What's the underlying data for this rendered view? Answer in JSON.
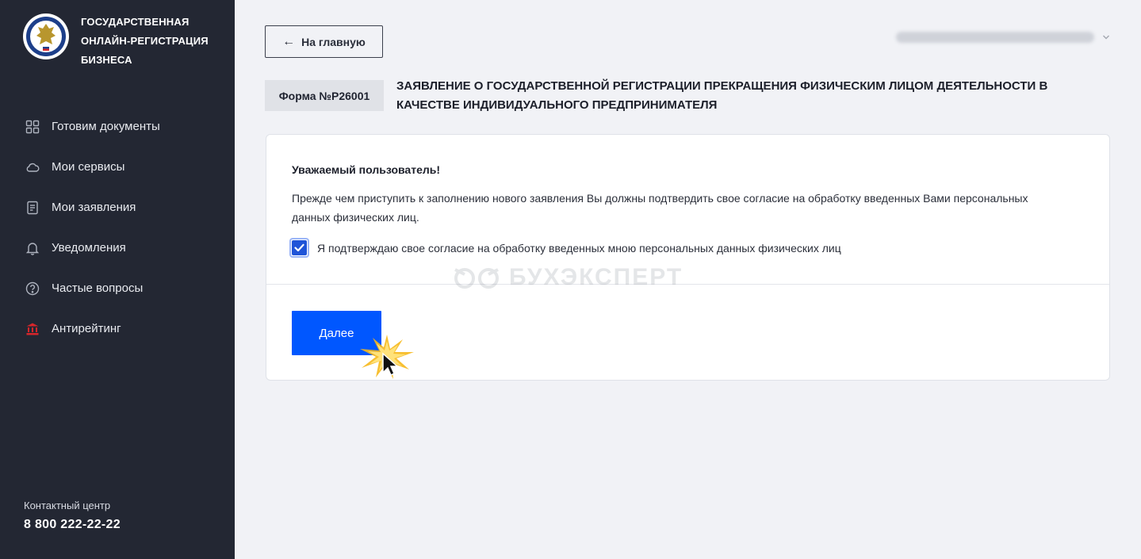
{
  "sidebar": {
    "brand": {
      "line1": "ГОСУДАРСТВЕННАЯ",
      "line2": "ОНЛАЙН-РЕГИСТРАЦИЯ",
      "line3": "БИЗНЕСА",
      "emblem_icon": "tax-service-emblem-icon"
    },
    "items": [
      {
        "label": "Готовим документы",
        "icon": "grid-icon"
      },
      {
        "label": "Мои сервисы",
        "icon": "cloud-icon"
      },
      {
        "label": "Мои заявления",
        "icon": "document-icon"
      },
      {
        "label": "Уведомления",
        "icon": "bell-icon"
      },
      {
        "label": "Частые вопросы",
        "icon": "question-icon"
      },
      {
        "label": "Антирейтинг",
        "icon": "bank-icon"
      }
    ],
    "contact": {
      "label": "Контактный центр",
      "phone": "8 800 222-22-22"
    }
  },
  "header": {
    "back_label": "На главную",
    "back_icon": "arrow-left-icon",
    "user_menu_icon": "chevron-down-icon"
  },
  "form": {
    "number": "Форма №Р26001",
    "title": "ЗАЯВЛЕНИЕ О ГОСУДАРСТВЕННОЙ РЕГИСТРАЦИИ ПРЕКРАЩЕНИЯ ФИЗИЧЕСКИМ ЛИЦОМ ДЕЯТЕЛЬНОСТИ В КАЧЕСТВЕ ИНДИВИДУАЛЬНОГО ПРЕДПРИНИМАТЕЛЯ"
  },
  "consent": {
    "greeting": "Уважаемый пользователь!",
    "notice": "Прежде чем приступить к заполнению нового заявления Вы должны подтвердить свое согласие на обработку введенных Вами персональных данных физических лиц.",
    "checkbox_label": "Я подтверждаю свое согласие на обработку введенных мною персональных данных физических лиц",
    "checked": true
  },
  "actions": {
    "next_label": "Далее"
  },
  "watermark": {
    "text": "БУХЭКСПЕРТ"
  },
  "colors": {
    "sidebar_bg": "#232733",
    "accent": "#0057ff",
    "checkbox": "#1f54d8",
    "antirating_icon": "#d6262b"
  }
}
